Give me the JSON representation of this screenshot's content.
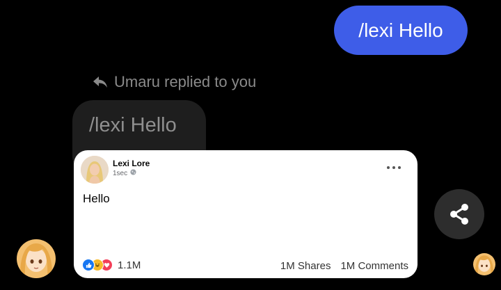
{
  "sent_message": {
    "text": "/lexi Hello"
  },
  "reply_indicator": {
    "text": "Umaru replied to you",
    "icon": "reply-arrow-icon"
  },
  "quoted_message": {
    "text": "/lexi Hello"
  },
  "post_card": {
    "author": "Lexi Lore",
    "time": "1sec",
    "privacy_icon": "globe-icon",
    "body": "Hello",
    "reaction_count": "1.1M",
    "shares": "1M Shares",
    "comments": "1M Comments",
    "reactions": [
      "like-icon",
      "haha-icon",
      "love-icon"
    ]
  },
  "colors": {
    "sent_bubble": "#3e5de8",
    "quoted_bubble": "#1e1e1e",
    "background": "#000000",
    "share_button": "#2d2d2d"
  }
}
